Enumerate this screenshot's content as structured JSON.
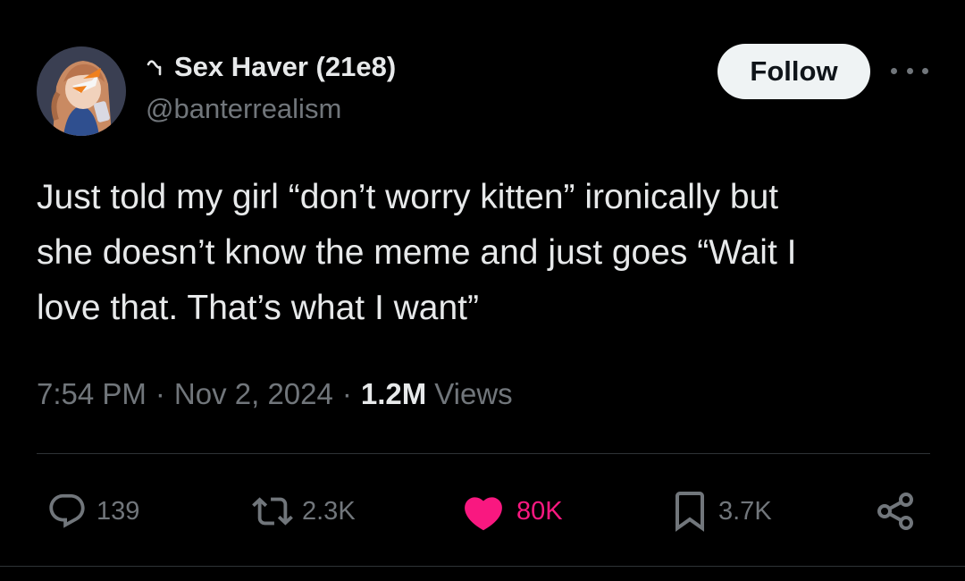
{
  "user": {
    "display_name": "Sex Haver (21e8)",
    "handle": "@banterrealism",
    "name_icon": "tilde-squiggle-icon",
    "avatar": "anime-character-avatar"
  },
  "follow_label": "Follow",
  "more_icon": "more-dots-icon",
  "tweet": {
    "text": "Just told my girl “don’t worry kitten” ironically but\nshe doesn’t know the meme and just goes “Wait I\nlove that. That’s what I want”",
    "time": "7:54 PM",
    "separator": "·",
    "date": "Nov 2, 2024",
    "views_count": "1.2M",
    "views_label": "Views"
  },
  "actions": {
    "reply": {
      "icon": "reply-icon",
      "count": "139"
    },
    "retweet": {
      "icon": "retweet-icon",
      "count": "2.3K"
    },
    "like": {
      "icon": "heart-icon",
      "count": "80K",
      "liked": true
    },
    "bookmark": {
      "icon": "bookmark-icon",
      "count": "3.7K"
    },
    "share": {
      "icon": "share-icon"
    }
  },
  "colors": {
    "background": "#000000",
    "text_primary": "#e7e9ea",
    "text_secondary": "#71767b",
    "like_active": "#f91880",
    "follow_bg": "#eff3f4",
    "divider": "#2f3336"
  }
}
